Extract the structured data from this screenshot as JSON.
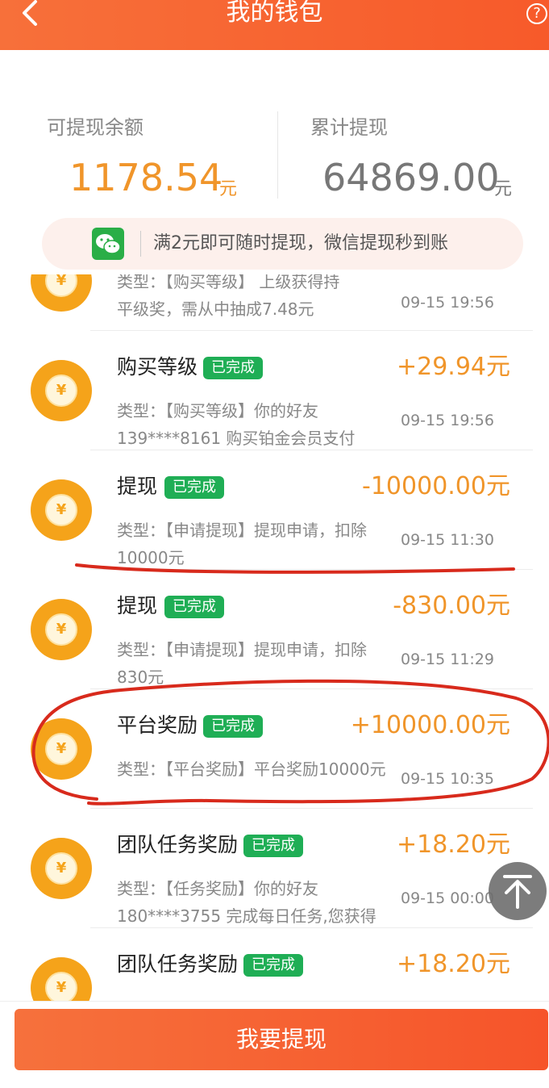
{
  "header": {
    "title": "我的钱包",
    "back_icon": "chevron-left-icon",
    "help_icon": "question-circle-icon",
    "help_glyph": "?"
  },
  "balance": {
    "available_label": "可提现余额",
    "available_amount": "1178.54",
    "available_unit": "元",
    "total_label": "累计提现",
    "total_amount": "64869.00",
    "total_unit": "元"
  },
  "notice": {
    "icon": "wechat-icon",
    "text": "满2元即可随时提现，微信提现秒到账"
  },
  "transactions": [
    {
      "title": "",
      "status": "",
      "amount": "",
      "desc": "类型：【购买等级】 上级获得持\n平级奖，需从中抽成7.48元",
      "time": "09-15 19:56"
    },
    {
      "title": "购买等级",
      "status": "已完成",
      "amount": "+29.94元",
      "desc": "类型：【购买等级】你的好友139****8161 购买铂金会员支付",
      "time": "09-15 19:56"
    },
    {
      "title": "提现",
      "status": "已完成",
      "amount": "-10000.00元",
      "desc": "类型：【申请提现】提现申请，扣除10000元",
      "time": "09-15 11:30"
    },
    {
      "title": "提现",
      "status": "已完成",
      "amount": "-830.00元",
      "desc": "类型：【申请提现】提现申请，扣除830元",
      "time": "09-15 11:29"
    },
    {
      "title": "平台奖励",
      "status": "已完成",
      "amount": "+10000.00元",
      "desc": "类型：【平台奖励】平台奖励10000元",
      "time": "09-15 10:35"
    },
    {
      "title": "团队任务奖励",
      "status": "已完成",
      "amount": "+18.20元",
      "desc": "类型：【任务奖励】你的好友180****3755 完成每日任务,您获得",
      "time": "09-15 00:00"
    },
    {
      "title": "团队任务奖励",
      "status": "已完成",
      "amount": "+18.20元",
      "desc": "",
      "time": ""
    }
  ],
  "coin_glyph": "¥",
  "scroll_top_icon": "arrow-up-icon",
  "withdraw_button": "我要提现",
  "colors": {
    "header": "#f75a2a",
    "amount": "#f0952a",
    "badge": "#1fae55",
    "annotation": "#d82a1c"
  }
}
